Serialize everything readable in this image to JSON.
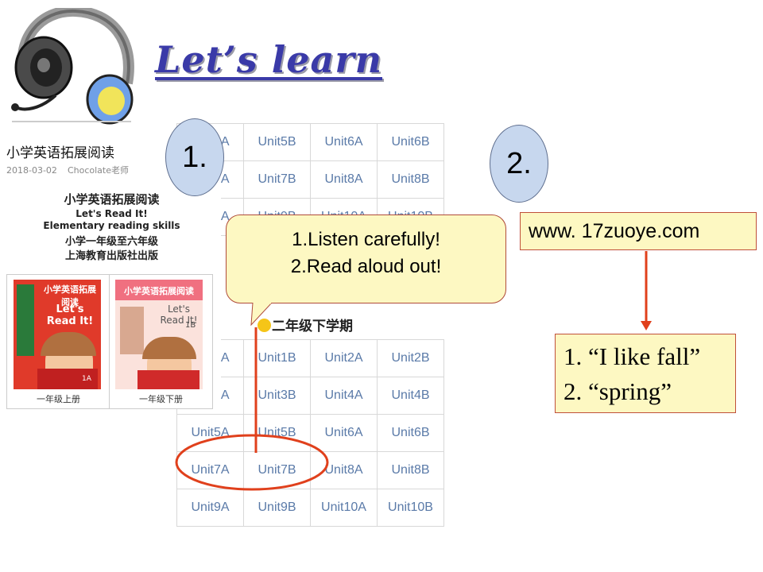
{
  "slide": {
    "title": "Let’s learn"
  },
  "article": {
    "title": "小学英语拓展阅读",
    "date": "2018-03-02",
    "author": "Chocolate老师",
    "book_lines": [
      "小学英语拓展阅读",
      "Let's Read It!",
      "Elementary reading skills",
      "小学一年级至六年级",
      "上海教育出版社出版"
    ],
    "books": [
      {
        "cover_title": "小学英语拓展阅读",
        "cover_sub": "Let's Read It!",
        "cover_tag": "1A",
        "caption": "一年级上册"
      },
      {
        "cover_title": "小学英语拓展阅读",
        "cover_sub": "Let's Read It!",
        "cover_tag": "1B",
        "caption": "一年级下册"
      }
    ]
  },
  "tables": {
    "top": [
      [
        "Unit5A",
        "Unit5B",
        "Unit6A",
        "Unit6B"
      ],
      [
        "Unit7A",
        "Unit7B",
        "Unit8A",
        "Unit8B"
      ],
      [
        "Unit9A",
        "Unit9B",
        "Unit10A",
        "Unit10B"
      ]
    ],
    "grade_label": "二年级下学期",
    "bottom": [
      [
        "Unit1A",
        "Unit1B",
        "Unit2A",
        "Unit2B"
      ],
      [
        "Unit3A",
        "Unit3B",
        "Unit4A",
        "Unit4B"
      ],
      [
        "Unit5A",
        "Unit5B",
        "Unit6A",
        "Unit6B"
      ],
      [
        "Unit7A",
        "Unit7B",
        "Unit8A",
        "Unit8B"
      ],
      [
        "Unit9A",
        "Unit9B",
        "Unit10A",
        "Unit10B"
      ]
    ]
  },
  "markers": {
    "one": "1.",
    "two": "2."
  },
  "callout": {
    "line1": "1.Listen carefully!",
    "line2": "2.Read aloud out!"
  },
  "website": {
    "url": "www. 17zuoye.com"
  },
  "answers": {
    "line1": "1. “I like fall”",
    "line2": "2. “spring”"
  },
  "colors": {
    "title": "#3a3aa8",
    "callout_fill": "#fdf8c2",
    "circle_fill": "#c7d7ee",
    "arrow": "#e0401c",
    "table_text": "#5a7aa8"
  },
  "icons": [
    "headphone-icon",
    "smiley-icon"
  ]
}
